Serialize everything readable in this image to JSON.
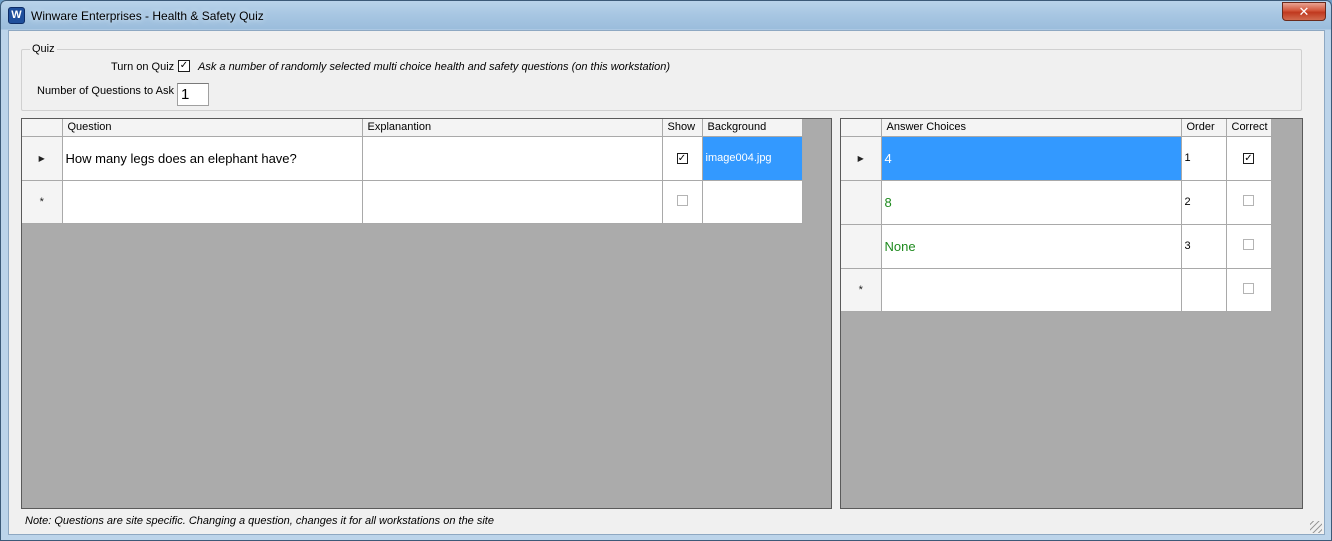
{
  "window": {
    "title": "Winware Enterprises - Health & Safety Quiz",
    "close_label": "✕"
  },
  "quiz": {
    "group_label": "Quiz",
    "turn_on_label": "Turn on Quiz",
    "turn_on_checked": true,
    "description": "Ask a number of randomly selected multi choice health and safety questions (on this workstation)",
    "num_questions_label": "Number of Questions to Ask",
    "num_questions_value": "1"
  },
  "questions_grid": {
    "columns": {
      "question": "Question",
      "explanation": "Explanantion",
      "show": "Show",
      "background": "Background"
    },
    "rows": [
      {
        "question": "How many legs does an elephant have?",
        "explanation": "",
        "show": true,
        "background": "image004.jpg"
      }
    ]
  },
  "answers_grid": {
    "columns": {
      "answer": "Answer Choices",
      "order": "Order",
      "correct": "Correct"
    },
    "rows": [
      {
        "answer": "4",
        "order": "1",
        "correct": true
      },
      {
        "answer": "8",
        "order": "2",
        "correct": false
      },
      {
        "answer": "None",
        "order": "3",
        "correct": false
      }
    ]
  },
  "footer": {
    "note": "Note: Questions are site specific. Changing a question, changes it for all workstations on the site"
  },
  "glyphs": {
    "checked": "✓",
    "current_row": "▶",
    "new_row": "*"
  }
}
